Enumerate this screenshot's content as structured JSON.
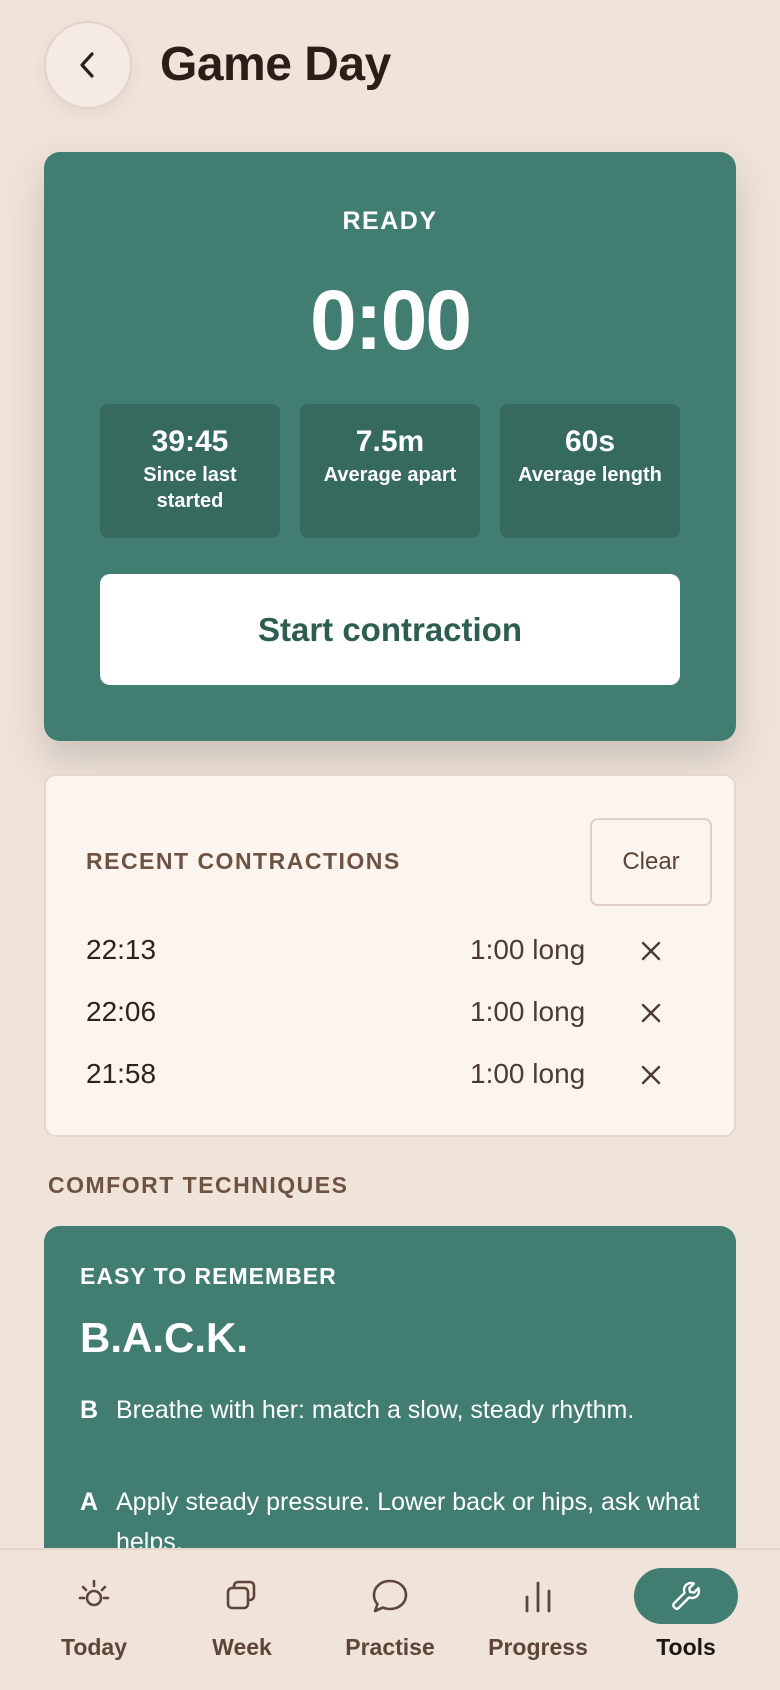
{
  "header": {
    "title": "Game Day",
    "back_icon": "chevron-left-icon"
  },
  "timer": {
    "status": "READY",
    "time": "0:00",
    "stats": [
      {
        "value": "39:45",
        "label": "Since last started"
      },
      {
        "value": "7.5m",
        "label": "Average apart"
      },
      {
        "value": "60s",
        "label": "Average length"
      }
    ],
    "start_label": "Start contraction"
  },
  "recent": {
    "heading": "RECENT CONTRACTIONS",
    "clear_label": "Clear",
    "items": [
      {
        "time": "22:13",
        "length": "1:00 long"
      },
      {
        "time": "22:06",
        "length": "1:00 long"
      },
      {
        "time": "21:58",
        "length": "1:00 long"
      }
    ]
  },
  "comfort": {
    "heading": "COMFORT TECHNIQUES",
    "eyebrow": "EASY TO REMEMBER",
    "acronym": "B.A.C.K.",
    "techniques": [
      {
        "letter": "B",
        "text": "Breathe with her: match a slow, steady rhythm."
      },
      {
        "letter": "A",
        "text": "Apply steady pressure. Lower back or hips, ask what helps."
      }
    ]
  },
  "nav": {
    "items": [
      {
        "label": "Today",
        "icon": "sun-icon",
        "active": false
      },
      {
        "label": "Week",
        "icon": "stack-icon",
        "active": false
      },
      {
        "label": "Practise",
        "icon": "chat-bubble-icon",
        "active": false
      },
      {
        "label": "Progress",
        "icon": "bar-chart-icon",
        "active": false
      },
      {
        "label": "Tools",
        "icon": "wrench-icon",
        "active": true
      }
    ]
  },
  "colors": {
    "background": "#f0e3da",
    "accent": "#417d70",
    "card": "#fbf4ef"
  }
}
